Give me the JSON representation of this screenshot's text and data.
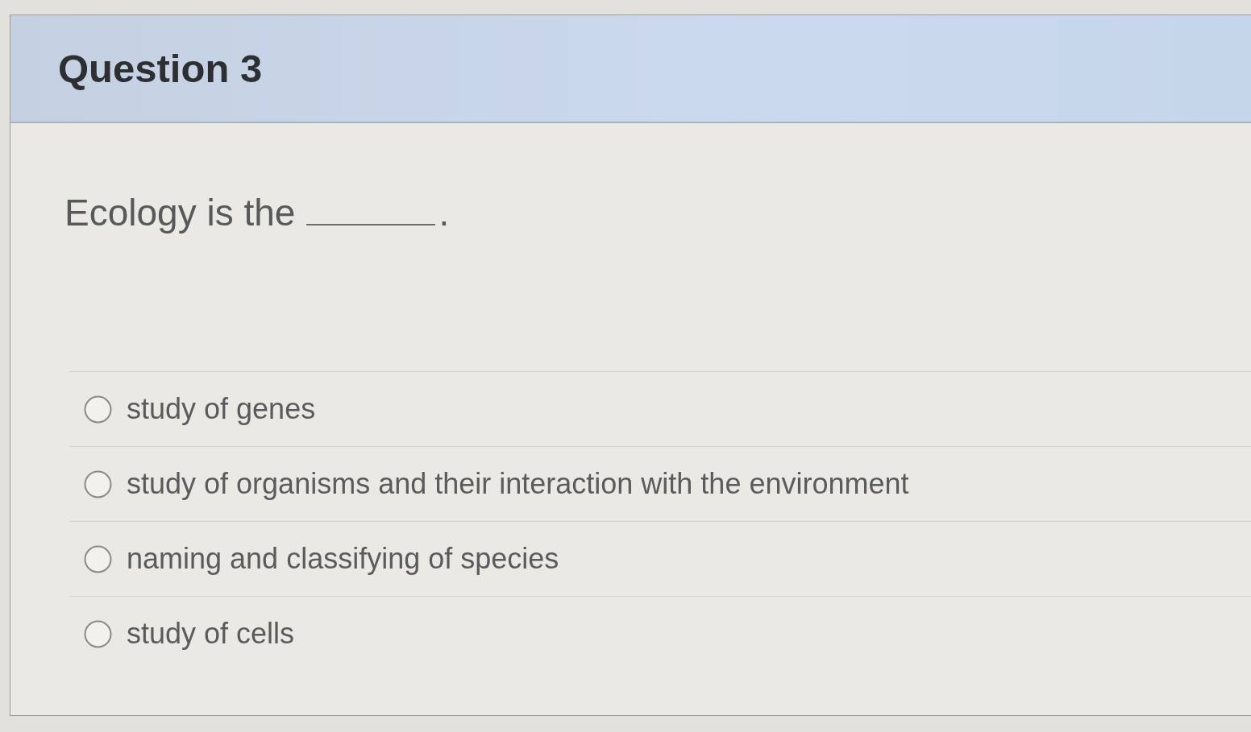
{
  "question": {
    "title": "Question 3",
    "prompt": {
      "text": "Ecology is the",
      "blank": true,
      "ending": "."
    },
    "answer_options": [
      {
        "label": "study of genes",
        "selected": false
      },
      {
        "label": "study of organisms and their interaction with the environment",
        "selected": false
      },
      {
        "label": "naming and classifying of species",
        "selected": false
      },
      {
        "label": "study of cells",
        "selected": false
      }
    ]
  }
}
